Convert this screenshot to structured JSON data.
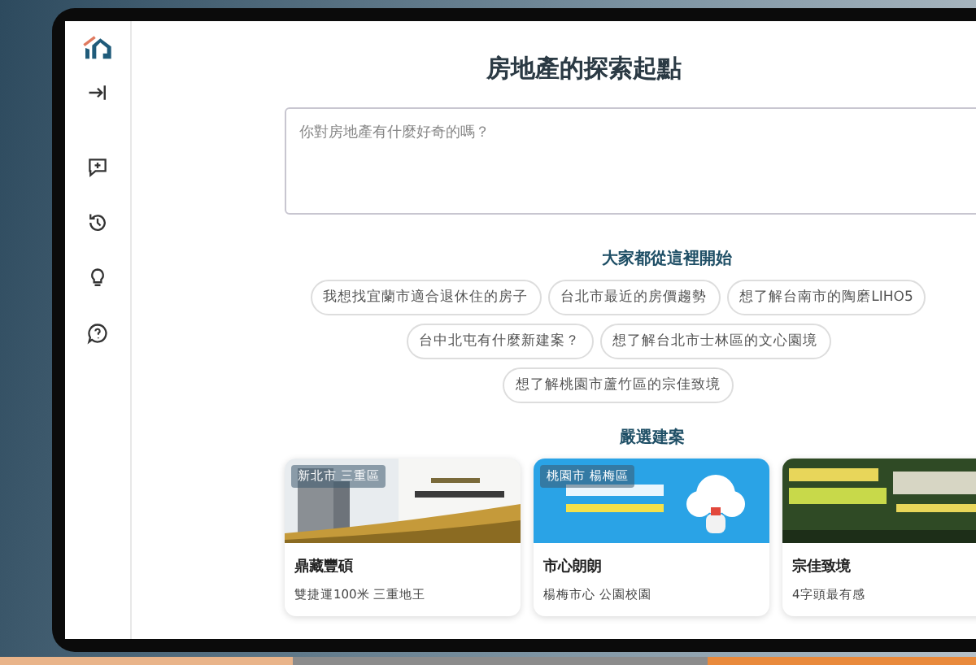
{
  "sidebar": {
    "items": [
      {
        "kind": "collapse"
      },
      {
        "kind": "new-chat"
      },
      {
        "kind": "history"
      },
      {
        "kind": "tips"
      },
      {
        "kind": "help"
      }
    ]
  },
  "main": {
    "title": "房地產的探索起點",
    "query": {
      "placeholder": "你對房地產有什麼好奇的嗎？"
    },
    "suggestions": {
      "heading": "大家都從這裡開始",
      "rows": [
        [
          "我想找宜蘭市適合退休住的房子",
          "台北市最近的房價趨勢",
          "想了解台南市的陶磨LIHO5"
        ],
        [
          "台中北屯有什麼新建案？",
          "想了解台北市士林區的文心園境"
        ],
        [
          "想了解桃園市蘆竹區的宗佳致境"
        ]
      ]
    },
    "featured": {
      "heading": "嚴選建案",
      "cards": [
        {
          "tag": "新北市 三重區",
          "name": "鼎藏豐碩",
          "desc": "雙捷運100米 三重地王"
        },
        {
          "tag": "桃園市 楊梅區",
          "name": "市心朗朗",
          "desc": "楊梅市心 公園校園"
        },
        {
          "name": "宗佳致境",
          "desc": "4字頭最有感"
        }
      ]
    }
  }
}
